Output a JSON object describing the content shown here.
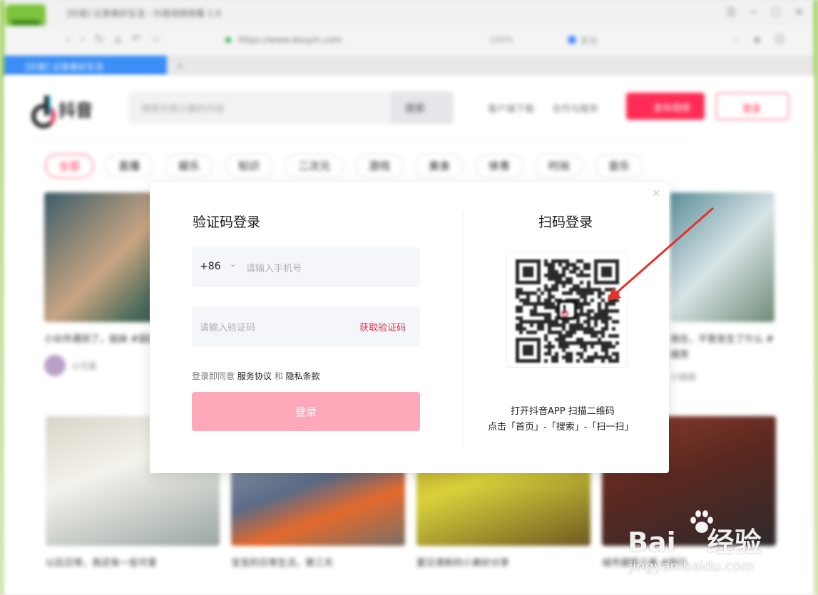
{
  "browser": {
    "window_title": "[抖音] 记录美好生活 - 抖音视频观看 1.0",
    "url": "https://www.douyin.com",
    "zoom": "100%",
    "shield_label": "安全",
    "tab_title": "[抖音] 记录美好生活"
  },
  "header": {
    "logo_text": "抖音",
    "search_placeholder": "搜索你感兴趣的内容",
    "search_button": "搜索",
    "links": [
      "客户端下载",
      "合作与服务"
    ],
    "upload_button": "发布视频",
    "login_button": "登录"
  },
  "categories": [
    "全部",
    "直播",
    "娱乐",
    "知识",
    "二次元",
    "游戏",
    "美食",
    "体育",
    "时尚",
    "音乐"
  ],
  "cards_row1": [
    {
      "title": "小伙伴遇到了，姐妹 #国民 #搞笑 #",
      "author": "小可爱"
    },
    {
      "title": "我在，不管发生了什么 #搞笑",
      "author": "小姐姐"
    }
  ],
  "cards_row2": [
    {
      "title": "以后日常，我还有一些可爱",
      "author": ""
    },
    {
      "title": "宝宝的日常生活，第三天",
      "author": ""
    },
    {
      "title": "夏日清新的小美好分享",
      "author": ""
    },
    {
      "title": "城市建筑之美 #旅行",
      "author": ""
    }
  ],
  "modal": {
    "left_title": "验证码登录",
    "country_code": "+86",
    "phone_placeholder": "请输入手机号",
    "code_placeholder": "请输入验证码",
    "get_code": "获取验证码",
    "agree_prefix": "登录即同意",
    "terms": "服务协议",
    "and": "和",
    "privacy": "隐私条款",
    "login_button": "登录",
    "right_title": "扫码登录",
    "qr_hint_line1": "打开抖音APP 扫描二维码",
    "qr_hint_line2": "点击「首页」-「搜索」-「扫一扫」"
  },
  "watermark": {
    "logo": "Bai",
    "logo_suffix": "经验",
    "url": "jingyan.baidu.com"
  },
  "colors": {
    "brand_red": "#fe2c55",
    "login_disabled": "#fda9b9",
    "get_code": "#e0344c",
    "arrow": "#e8302a"
  }
}
